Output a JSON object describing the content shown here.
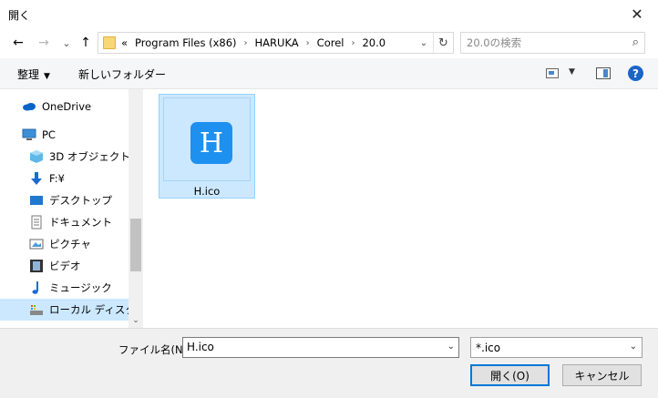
{
  "window": {
    "title": "開く",
    "close_glyph": "✕"
  },
  "nav": {
    "back_glyph": "←",
    "forward_glyph": "→",
    "recent_glyph": "⌄",
    "up_glyph": "↑",
    "breadcrumb": {
      "overflow": "«",
      "items": [
        "Program Files (x86)",
        "HARUKA",
        "Corel",
        "20.0"
      ],
      "separator": "›"
    },
    "dropdown_glyph": "⌄",
    "refresh_glyph": "↻",
    "search_placeholder": "20.0の検索",
    "search_icon": "search-icon"
  },
  "toolbar": {
    "organize_label": "整理",
    "new_folder_label": "新しいフォルダー",
    "help_label": "?",
    "caret": "▼"
  },
  "sidebar": {
    "items": [
      {
        "label": "OneDrive",
        "icon": "cloud-icon"
      },
      {
        "label": "PC",
        "icon": "computer-icon"
      },
      {
        "label": "3D オブジェクト",
        "icon": "3d-objects-icon"
      },
      {
        "label": "F:¥",
        "icon": "download-arrow-icon"
      },
      {
        "label": "デスクトップ",
        "icon": "desktop-icon"
      },
      {
        "label": "ドキュメント",
        "icon": "document-icon"
      },
      {
        "label": "ピクチャ",
        "icon": "pictures-icon"
      },
      {
        "label": "ビデオ",
        "icon": "video-icon"
      },
      {
        "label": "ミュージック",
        "icon": "music-icon"
      },
      {
        "label": "ローカル ディスク (C",
        "icon": "local-disk-icon"
      }
    ],
    "scroll_down_glyph": "⌄"
  },
  "files": [
    {
      "name": "H.ico",
      "icon_letter": "H"
    }
  ],
  "bottom": {
    "filename_label": "ファイル名(N):",
    "filename_value": "H.ico",
    "filetype_value": "*.ico",
    "dropdown_glyph": "⌄",
    "open_label": "開く(O)",
    "cancel_label": "キャンセル"
  },
  "colors": {
    "accent": "#0078d7",
    "selection": "#cce8ff",
    "file_icon_bg": "#1e90f0"
  }
}
